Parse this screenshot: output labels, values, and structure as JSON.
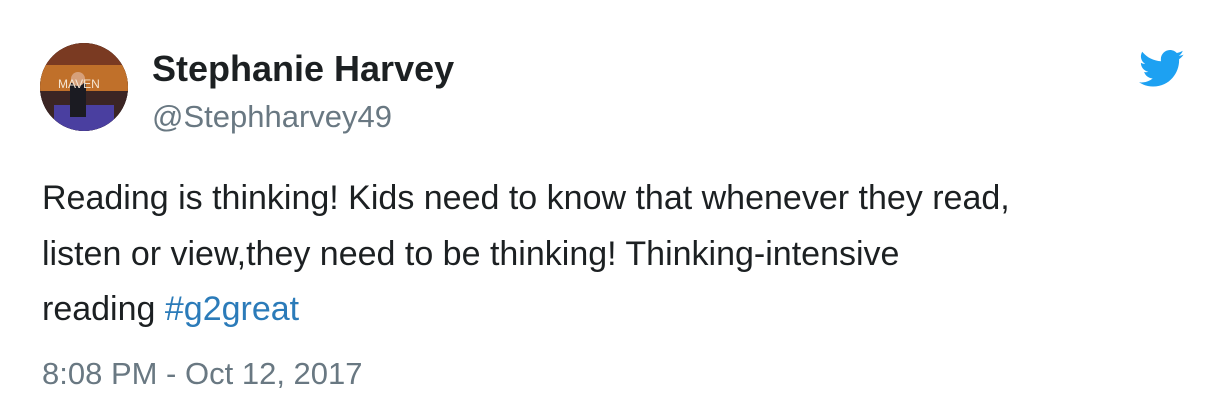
{
  "author": {
    "name": "Stephanie Harvey",
    "handle": "@Stephharvey49",
    "avatar_sign_text": "MAVEN"
  },
  "tweet": {
    "text_lines": [
      "Reading is thinking! Kids need to know that whenever they read,",
      "listen or view,they need to be thinking! Thinking-intensive",
      "reading "
    ],
    "hashtag": "#g2great",
    "timestamp": "8:08 PM - Oct 12, 2017"
  },
  "icons": {
    "brand": "twitter-bird-icon"
  },
  "colors": {
    "name": "#1c2022",
    "secondary": "#697882",
    "link": "#2b7bb9",
    "brand_blue": "#1da1f2"
  }
}
